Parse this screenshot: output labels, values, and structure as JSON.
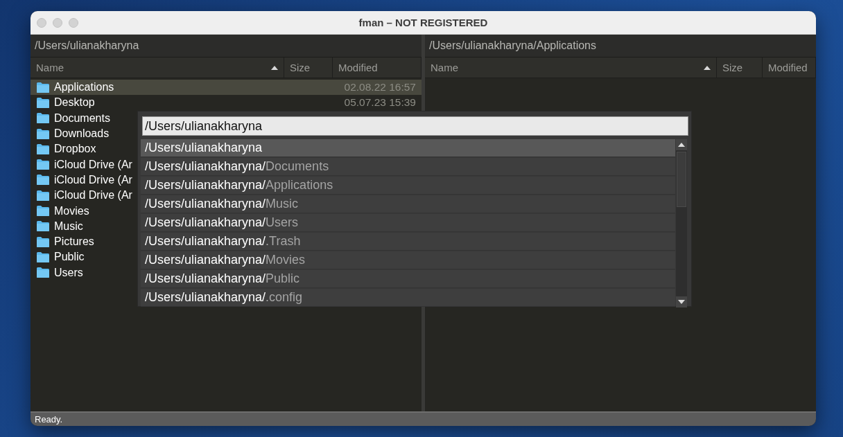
{
  "window": {
    "title": "fman – NOT REGISTERED"
  },
  "panes": [
    {
      "path": "/Users/ulianakharyna",
      "columns": [
        {
          "label": "Name",
          "sorted": true
        },
        {
          "label": "Size",
          "sorted": false
        },
        {
          "label": "Modified",
          "sorted": false
        }
      ],
      "rows": [
        {
          "name": "Applications",
          "modified": "02.08.22 16:57",
          "selected": true
        },
        {
          "name": "Desktop",
          "modified": "05.07.23 15:39",
          "selected": false
        },
        {
          "name": "Documents",
          "selected": false
        },
        {
          "name": "Downloads",
          "selected": false
        },
        {
          "name": "Dropbox",
          "selected": false
        },
        {
          "name": "iCloud Drive (Ar",
          "selected": false
        },
        {
          "name": "iCloud Drive (Ar",
          "selected": false
        },
        {
          "name": "iCloud Drive (Ar",
          "selected": false
        },
        {
          "name": "Movies",
          "selected": false
        },
        {
          "name": "Music",
          "selected": false
        },
        {
          "name": "Pictures",
          "selected": false
        },
        {
          "name": "Public",
          "selected": false
        },
        {
          "name": "Users",
          "selected": false
        }
      ]
    },
    {
      "path": "/Users/ulianakharyna/Applications",
      "columns": [
        {
          "label": "Name",
          "sorted": true
        },
        {
          "label": "Size",
          "sorted": false
        },
        {
          "label": "Modified",
          "sorted": false
        }
      ]
    }
  ],
  "quick_open": {
    "value": "/Users/ulianakharyna",
    "suggestions": [
      {
        "base": "/Users/ulianakharyna",
        "selected": true
      },
      {
        "base": "/Users/ulianakharyna/",
        "rest": "Documents",
        "selected": false
      },
      {
        "base": "/Users/ulianakharyna/",
        "rest": "Applications",
        "selected": false
      },
      {
        "base": "/Users/ulianakharyna/",
        "rest": "Music",
        "selected": false
      },
      {
        "base": "/Users/ulianakharyna/",
        "rest": "Users",
        "selected": false
      },
      {
        "base": "/Users/ulianakharyna/",
        "rest": ".Trash",
        "selected": false
      },
      {
        "base": "/Users/ulianakharyna/",
        "rest": "Movies",
        "selected": false
      },
      {
        "base": "/Users/ulianakharyna/",
        "rest": "Public",
        "selected": false
      },
      {
        "base": "/Users/ulianakharyna/",
        "rest": ".config",
        "selected": false
      }
    ]
  },
  "status_bar": "Ready."
}
